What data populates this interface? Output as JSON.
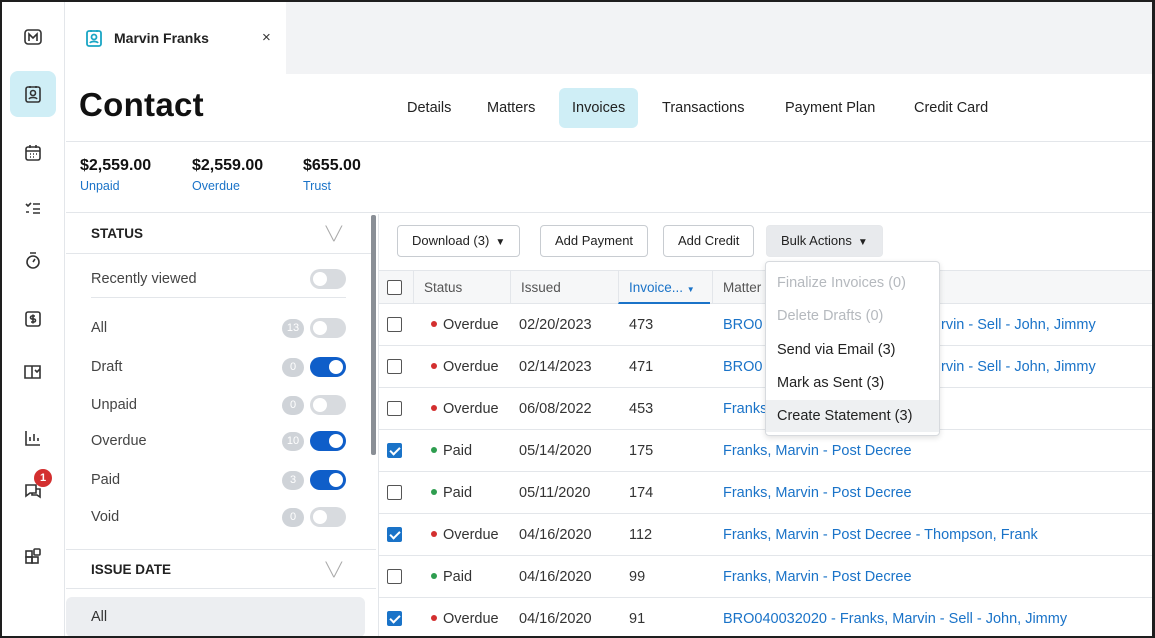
{
  "rail": {
    "items": [
      {
        "name": "logo-icon"
      },
      {
        "name": "contacts-icon"
      },
      {
        "name": "calendar-icon"
      },
      {
        "name": "tasks-icon"
      },
      {
        "name": "timer-icon"
      },
      {
        "name": "billing-icon"
      },
      {
        "name": "documents-icon"
      },
      {
        "name": "reports-icon"
      },
      {
        "name": "messages-icon",
        "badge": "1"
      },
      {
        "name": "apps-icon"
      }
    ]
  },
  "tab": {
    "title": "Marvin Franks",
    "close": "×"
  },
  "header": {
    "title": "Contact",
    "tabs": [
      "Details",
      "Matters",
      "Invoices",
      "Transactions",
      "Payment Plan",
      "Credit Card"
    ],
    "active_tab": "Invoices"
  },
  "summary": [
    {
      "amount": "$2,559.00",
      "label": "Unpaid"
    },
    {
      "amount": "$2,559.00",
      "label": "Overdue"
    },
    {
      "amount": "$655.00",
      "label": "Trust"
    }
  ],
  "filters": {
    "status_heading": "STATUS",
    "recently_viewed": "Recently viewed",
    "statuses": [
      {
        "label": "All",
        "count": "13",
        "on": false
      },
      {
        "label": "Draft",
        "count": "0",
        "on": true
      },
      {
        "label": "Unpaid",
        "count": "0",
        "on": false
      },
      {
        "label": "Overdue",
        "count": "10",
        "on": true
      },
      {
        "label": "Paid",
        "count": "3",
        "on": true
      },
      {
        "label": "Void",
        "count": "0",
        "on": false
      }
    ],
    "issue_date_heading": "ISSUE DATE",
    "issue_date_all": "All",
    "chevron": "╲╱"
  },
  "toolbar": {
    "download": "Download (3)",
    "add_payment": "Add Payment",
    "add_credit": "Add Credit",
    "bulk_actions": "Bulk Actions"
  },
  "table": {
    "headers": {
      "status": "Status",
      "issued": "Issued",
      "invoice": "Invoice...",
      "matter": "Matter"
    },
    "rows": [
      {
        "checked": false,
        "status": "Overdue",
        "issued": "02/20/2023",
        "invoice": "473",
        "matter": "BRO0",
        "matter_tail": "rvin - Sell - John, Jimmy"
      },
      {
        "checked": false,
        "status": "Overdue",
        "issued": "02/14/2023",
        "invoice": "471",
        "matter": "BRO0",
        "matter_tail": "rvin - Sell - John, Jimmy"
      },
      {
        "checked": false,
        "status": "Overdue",
        "issued": "06/08/2022",
        "invoice": "453",
        "matter": "Franks",
        "matter_tail": ""
      },
      {
        "checked": true,
        "status": "Paid",
        "issued": "05/14/2020",
        "invoice": "175",
        "matter": "Franks, Marvin - Post Decree",
        "matter_tail": ""
      },
      {
        "checked": false,
        "status": "Paid",
        "issued": "05/11/2020",
        "invoice": "174",
        "matter": "Franks, Marvin - Post Decree",
        "matter_tail": ""
      },
      {
        "checked": true,
        "status": "Overdue",
        "issued": "04/16/2020",
        "invoice": "112",
        "matter": "Franks, Marvin - Post Decree - Thompson, Frank",
        "matter_tail": ""
      },
      {
        "checked": false,
        "status": "Paid",
        "issued": "04/16/2020",
        "invoice": "99",
        "matter": "Franks, Marvin - Post Decree",
        "matter_tail": ""
      },
      {
        "checked": true,
        "status": "Overdue",
        "issued": "04/16/2020",
        "invoice": "91",
        "matter": "BRO040032020 - Franks, Marvin - Sell - John, Jimmy",
        "matter_tail": ""
      }
    ]
  },
  "bulk_menu": [
    {
      "label": "Finalize Invoices (0)",
      "disabled": true
    },
    {
      "label": "Delete Drafts (0)",
      "disabled": true
    },
    {
      "label": "Send via Email (3)",
      "disabled": false
    },
    {
      "label": "Mark as Sent (3)",
      "disabled": false
    },
    {
      "label": "Create Statement (3)",
      "disabled": false,
      "hover": true
    }
  ],
  "colors": {
    "overdue": "#d32f2f",
    "paid": "#2e9d4f",
    "accent": "#1a73c8",
    "active_bg": "#cfeef6"
  }
}
